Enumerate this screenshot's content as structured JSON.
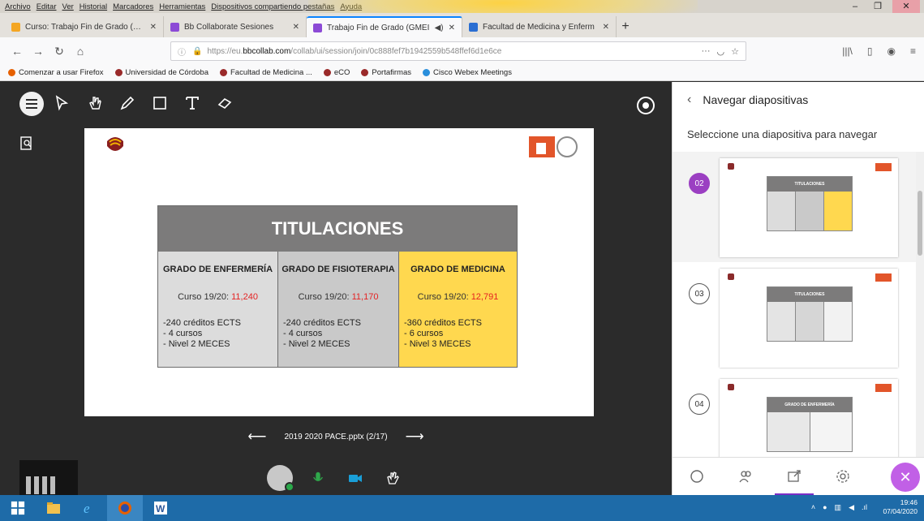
{
  "menu": [
    "Archivo",
    "Editar",
    "Ver",
    "Historial",
    "Marcadores",
    "Herramientas",
    "Dispositivos compartiendo pestañas",
    "Ayuda"
  ],
  "tabs": [
    {
      "title": "Curso: Trabajo Fin de Grado (G...",
      "color": "#f4a623",
      "active": false
    },
    {
      "title": "Bb Collaborate Sesiones",
      "color": "#8c4ad6",
      "active": false
    },
    {
      "title": "Trabajo Fin de Grado (GMEI",
      "color": "#8c4ad6",
      "active": true
    },
    {
      "title": "Facultad de Medicina y Enferm",
      "color": "#2a6ed2",
      "active": false
    }
  ],
  "url": {
    "prefix": "https://eu.",
    "host": "bbcollab.com",
    "path": "/collab/ui/session/join/0c888fef7b194255​9b548ffef6d1e6ce"
  },
  "bookmarks": [
    {
      "label": "Comenzar a usar Firefox",
      "color": "#e66000"
    },
    {
      "label": "Universidad de Córdoba",
      "color": "#9a2a2a"
    },
    {
      "label": "Facultad de Medicina ...",
      "color": "#9a2a2a"
    },
    {
      "label": "eCO",
      "color": "#9a2a2a"
    },
    {
      "label": "Portafirmas",
      "color": "#9a2a2a"
    },
    {
      "label": "Cisco Webex Meetings",
      "color": "#2a8fdc"
    }
  ],
  "slide": {
    "heading": "TITULACIONES",
    "columns": [
      {
        "title": "GRADO DE ENFERMERÍA",
        "curso_label": "Curso 19/20: ",
        "curso_num": "11,240",
        "items": [
          "-240 créditos ECTS",
          "- 4 cursos",
          "- Nivel 2 MECES"
        ]
      },
      {
        "title": "GRADO DE FISIOTERAPIA",
        "curso_label": "Curso 19/20: ",
        "curso_num": "11,170",
        "items": [
          "-240 créditos ECTS",
          "- 4 cursos",
          "- Nivel 2 MECES"
        ]
      },
      {
        "title": "GRADO DE MEDICINA",
        "curso_label": "Curso 19/20: ",
        "curso_num": "12,791",
        "items": [
          "-360 créditos ECTS",
          "- 6 cursos",
          "- Nivel 3 MECES"
        ]
      }
    ]
  },
  "slide_nav": {
    "label": "2019 2020 PACE.pptx  (2/17)"
  },
  "panel": {
    "title": "Navegar diapositivas",
    "subtitle": "Seleccione una diapositiva para navegar",
    "thumbs": [
      {
        "num": "02",
        "title": "TITULACIONES",
        "active": true
      },
      {
        "num": "03",
        "title": "TITULACIONES",
        "active": false
      },
      {
        "num": "04",
        "title": "GRADO DE ENFERMERÍA",
        "active": false
      }
    ]
  },
  "clock": {
    "time": "19:46",
    "date": "07/04/2020"
  },
  "colors": {
    "accent": "#7a2ec6",
    "yellow": "#ffd84f",
    "red": "#e52222"
  }
}
